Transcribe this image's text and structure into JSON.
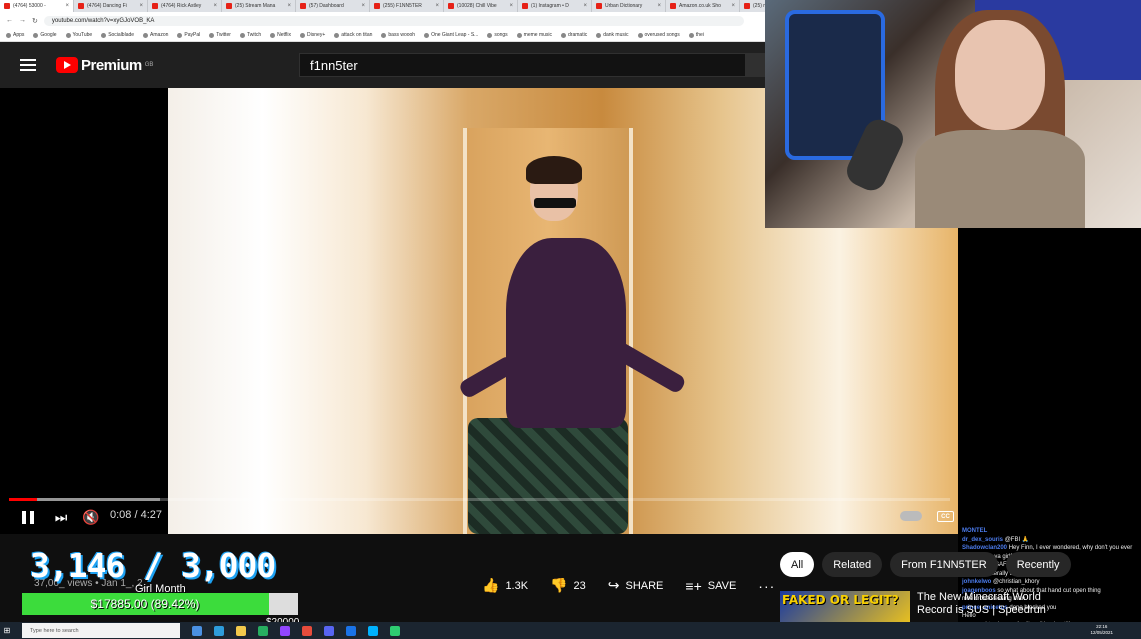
{
  "browser": {
    "tabs": [
      {
        "label": "(4764) 53000 -",
        "active": true
      },
      {
        "label": "(4764) Dancing Fi",
        "active": false
      },
      {
        "label": "(4764) Rick Astley",
        "active": false
      },
      {
        "label": "(25) Stream Mana",
        "active": false
      },
      {
        "label": "(57) Dashboard",
        "active": false
      },
      {
        "label": "(255) F1NN5TER",
        "active": false
      },
      {
        "label": "(10028) Chill Vibe",
        "active": false
      },
      {
        "label": "(1) Instagram • D",
        "active": false
      },
      {
        "label": "Urban Dictionary",
        "active": false
      },
      {
        "label": "Amazon.co.uk Sho",
        "active": false
      },
      {
        "label": "(25) m",
        "active": false
      }
    ],
    "url": "youtube.com/watch?v=xyGJoVOB_KA",
    "bookmarks": [
      "Apps",
      "Google",
      "YouTube",
      "Socialblade",
      "Amazon",
      "PayPal",
      "Twitter",
      "Twitch",
      "Netflix",
      "Disney+",
      "attack on titan",
      "bass woooh",
      "One Giant Leap - S...",
      "songs",
      "meme music",
      "dramatic",
      "dank music",
      "overused songs",
      "thei"
    ]
  },
  "youtube": {
    "logo_text": "Premium",
    "logo_region": "GB",
    "search_value": "f1nn5ter"
  },
  "player": {
    "time_current": "0:08",
    "time_total": "4:27",
    "progress": 0.03,
    "buffered": 0.16,
    "cc_label": "CC"
  },
  "video_info": {
    "views": "37,00_ views • Jan 1_, 2_"
  },
  "actions": {
    "like_count": "1.3K",
    "dislike_count": "23",
    "share_label": "SHARE",
    "save_label": "SAVE"
  },
  "chips": [
    "All",
    "Related",
    "From F1NN5TER",
    "Recently"
  ],
  "recommendation": {
    "thumb_text": "FAKED OR LEGIT?",
    "title": "The New Minecraft World Record is SUS | Speedrun"
  },
  "overlay": {
    "counter": "3,146 / 3,000",
    "goal_label": "Girl Month",
    "goal_text": "$17885.00 (89.42%)",
    "goal_fraction": 0.8942,
    "goal_target": "$20000"
  },
  "chat": [
    {
      "user": "MONTEL",
      "text": ""
    },
    {
      "user": "dr_dex_souris",
      "text": "@FBI 🙏"
    },
    {
      "user": "Shadowclan200",
      "text": "Hey Finn, I ever wondered, why don't you ever stream with ya girlfriend?"
    },
    {
      "user": "R Kinsman",
      "text": "SAFETY DOME"
    },
    {
      "user": "Churik07",
      "text": "literally dono walled"
    },
    {
      "user": "johnkelwo",
      "text": "@christian_khory"
    },
    {
      "user": "joagenboos",
      "text": "so what about that hand cut open thing"
    },
    {
      "user": "",
      "text": "nice crossdressing man"
    },
    {
      "user": "prince_anicetus",
      "text": "dono blocked you"
    },
    {
      "user": "",
      "text": "Hello"
    },
    {
      "user": "",
      "text": "you need to change the \"teen\" in about!!!"
    }
  ],
  "taskbar": {
    "search_placeholder": "Type here to search",
    "time": "22:16",
    "date": "12/05/2021"
  },
  "colors": {
    "yt_red": "#ff0000",
    "goal_green": "#3cdc3c",
    "counter_glow": "#1da1f2"
  }
}
